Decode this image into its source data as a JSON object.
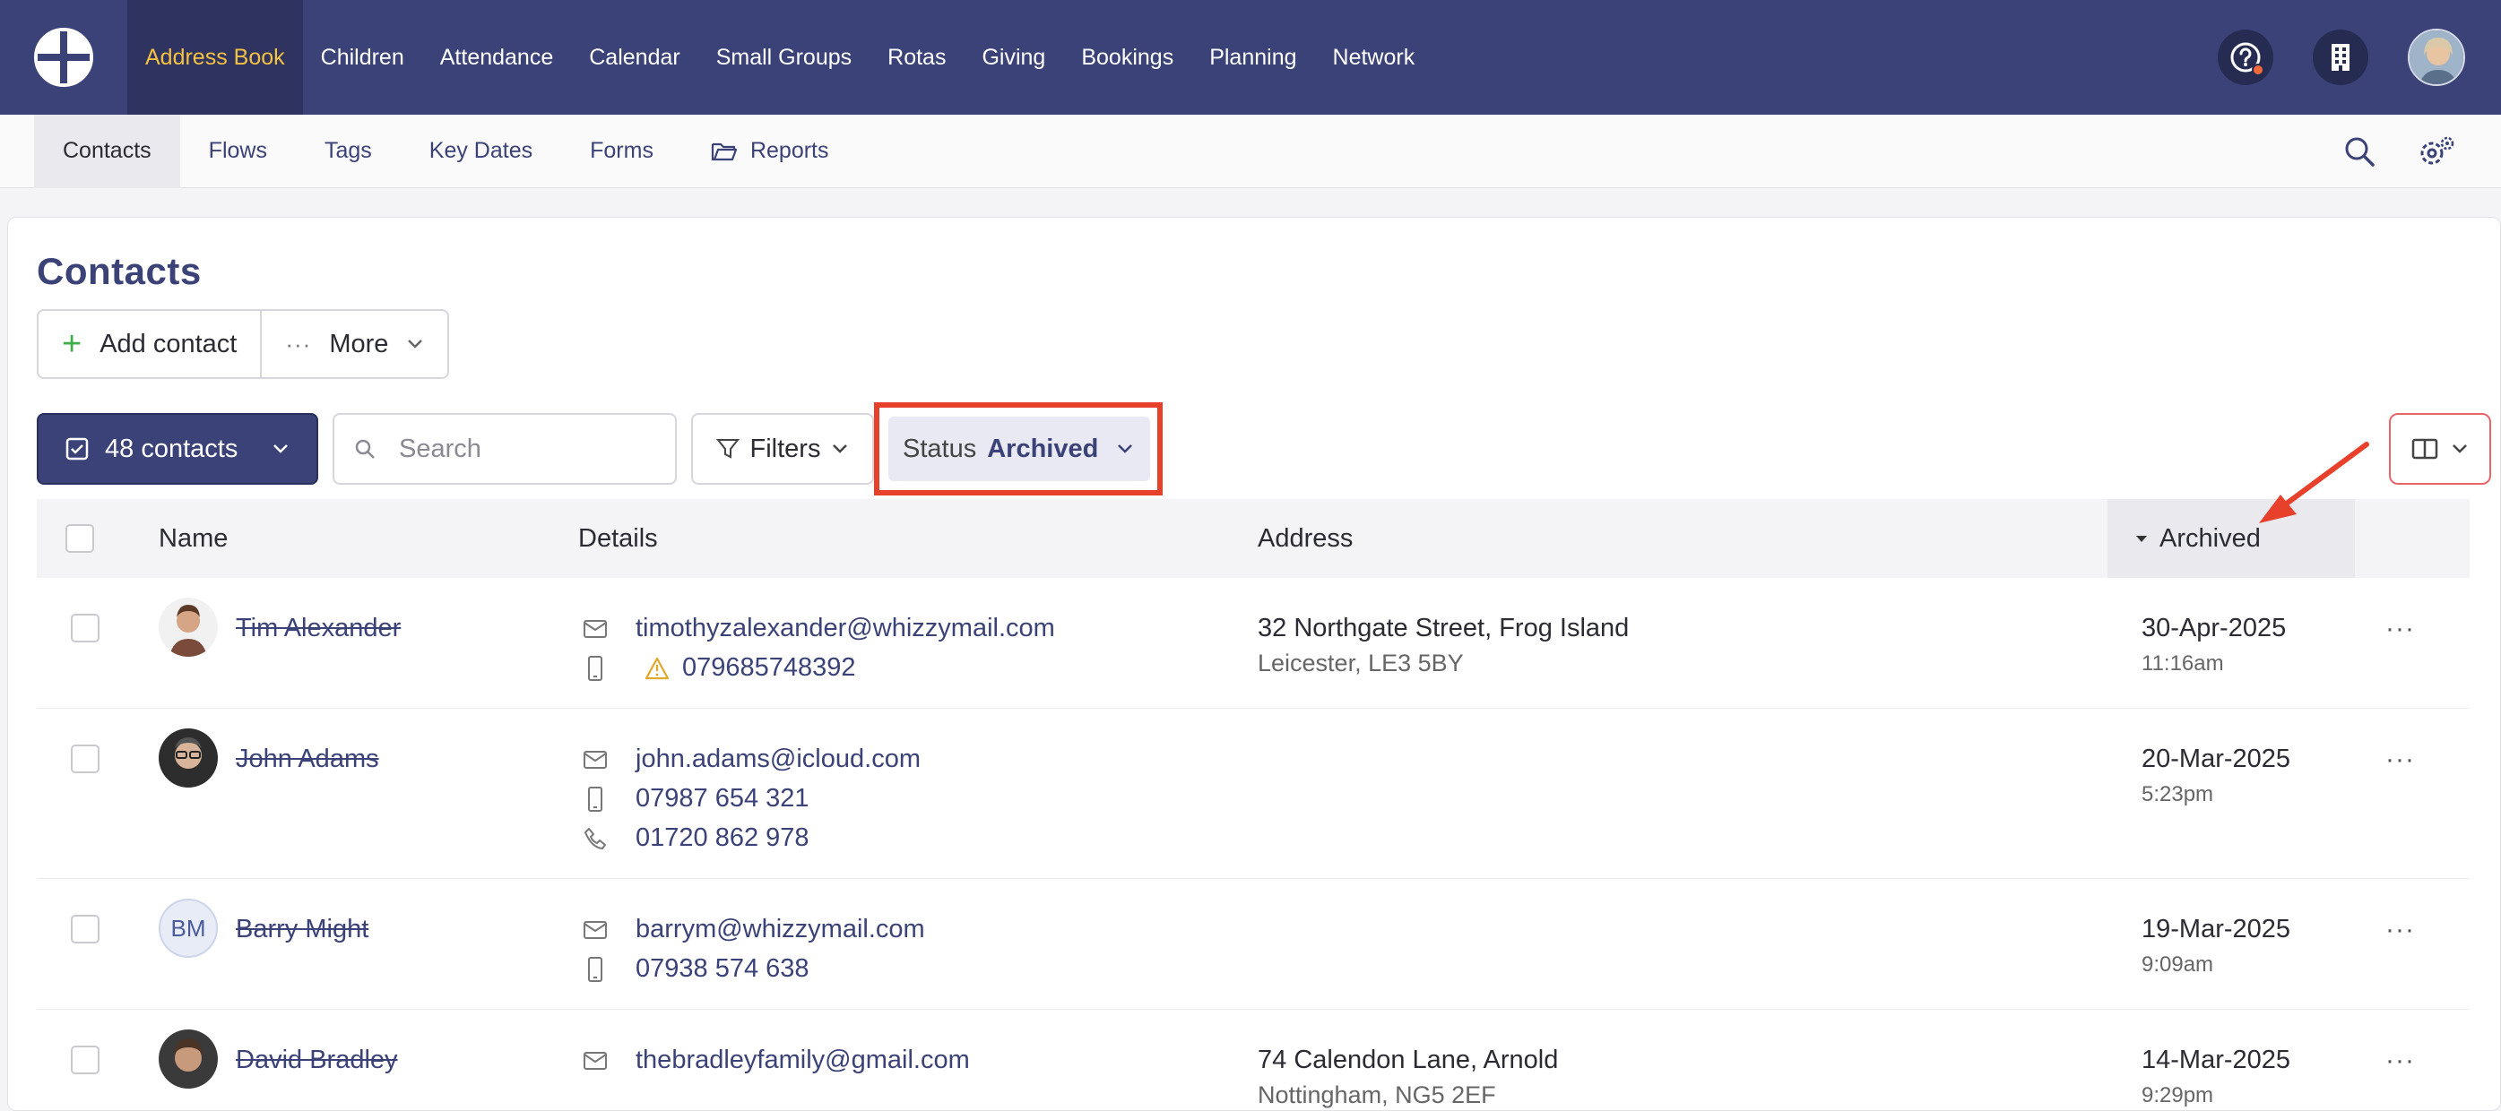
{
  "topnav": {
    "items": [
      {
        "label": "Address Book",
        "active": true
      },
      {
        "label": "Children"
      },
      {
        "label": "Attendance"
      },
      {
        "label": "Calendar"
      },
      {
        "label": "Small Groups"
      },
      {
        "label": "Rotas"
      },
      {
        "label": "Giving"
      },
      {
        "label": "Bookings"
      },
      {
        "label": "Planning"
      },
      {
        "label": "Network"
      }
    ],
    "icons": [
      "help-icon",
      "building-icon",
      "user-avatar"
    ]
  },
  "subnav": {
    "items": [
      {
        "label": "Contacts",
        "active": true
      },
      {
        "label": "Flows"
      },
      {
        "label": "Tags"
      },
      {
        "label": "Key Dates"
      },
      {
        "label": "Forms"
      },
      {
        "label": "Reports",
        "icon": "folder-open-icon"
      }
    ],
    "icons": [
      "search-icon",
      "settings-icon"
    ]
  },
  "page": {
    "title": "Contacts",
    "add_contact": "Add contact",
    "more": "More"
  },
  "toolbar": {
    "count": "48 contacts",
    "search_placeholder": "Search",
    "filters": "Filters",
    "status_label": "Status",
    "status_value": "Archived"
  },
  "table": {
    "headers": {
      "name": "Name",
      "details": "Details",
      "address": "Address",
      "archived": "Archived"
    },
    "rows": [
      {
        "name": "Tim Alexander",
        "email": "timothyzalexander@whizzymail.com",
        "mobile": "079685748392",
        "mobile_warning": true,
        "address_line1": "32 Northgate Street, Frog Island",
        "address_line2": "Leicester, LE3 5BY",
        "date": "30-Apr-2025",
        "time": "11:16am"
      },
      {
        "name": "John Adams",
        "email": "john.adams@icloud.com",
        "mobile": "07987 654 321",
        "phone": "01720 862 978",
        "address_line1": "",
        "address_line2": "",
        "date": "20-Mar-2025",
        "time": "5:23pm"
      },
      {
        "name": "Barry Might",
        "initials": "BM",
        "email": "barrym@whizzymail.com",
        "mobile": "07938 574 638",
        "address_line1": "",
        "address_line2": "",
        "date": "19-Mar-2025",
        "time": "9:09am"
      },
      {
        "name": "David Bradley",
        "email": "thebradleyfamily@gmail.com",
        "address_line1": "74 Calendon Lane, Arnold",
        "address_line2": "Nottingham, NG5 2EF",
        "date": "14-Mar-2025",
        "time": "9:29pm"
      }
    ]
  },
  "colors": {
    "nav_bg": "#3b4277",
    "nav_active_text": "#f5c142",
    "link": "#3b4277",
    "highlight": "#e8412b",
    "add_plus": "#3fae49"
  }
}
